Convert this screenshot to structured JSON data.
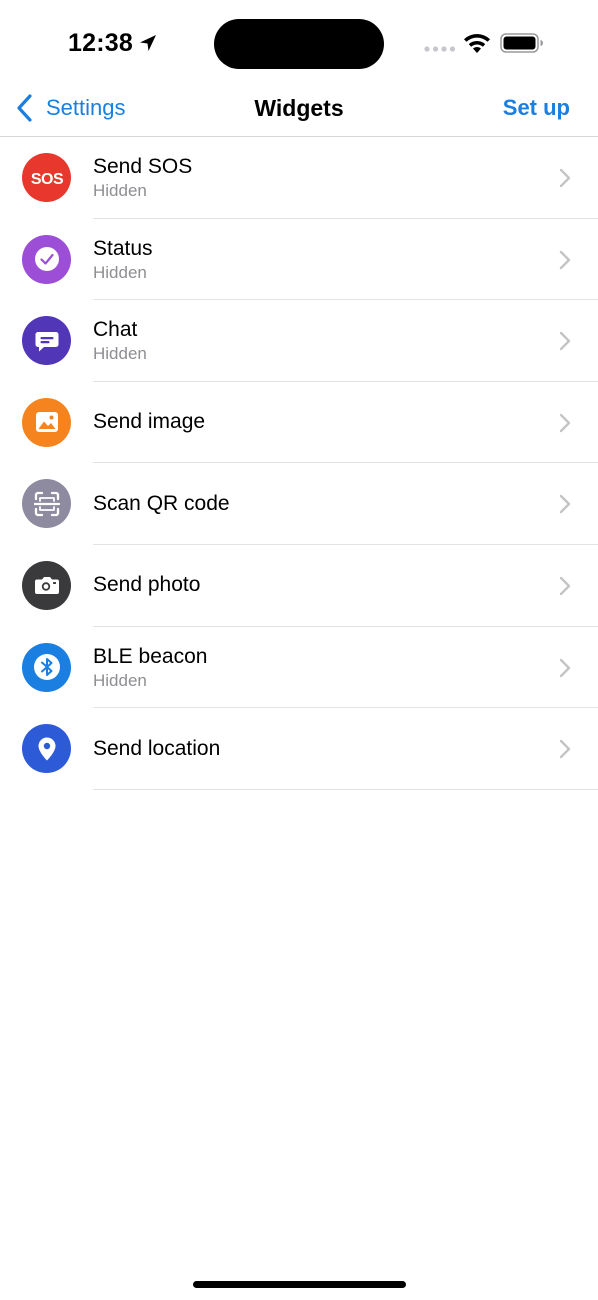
{
  "status_bar": {
    "time": "12:38",
    "icons": [
      "location-arrow-icon",
      "cellular-signal-icon",
      "wifi-icon",
      "battery-icon"
    ]
  },
  "nav": {
    "back_label": "Settings",
    "title": "Widgets",
    "action_label": "Set up"
  },
  "widgets": [
    {
      "title": "Send SOS",
      "subtitle": "Hidden",
      "icon": "sos-icon",
      "color": "#e8382e"
    },
    {
      "title": "Status",
      "subtitle": "Hidden",
      "icon": "checkmark-icon",
      "color": "#9c4fd6"
    },
    {
      "title": "Chat",
      "subtitle": "Hidden",
      "icon": "chat-bubble-icon",
      "color": "#5236b8"
    },
    {
      "title": "Send image",
      "subtitle": "",
      "icon": "image-icon",
      "color": "#f5841f"
    },
    {
      "title": "Scan QR code",
      "subtitle": "",
      "icon": "qr-scan-icon",
      "color": "#8e8aa0"
    },
    {
      "title": "Send photo",
      "subtitle": "",
      "icon": "camera-icon",
      "color": "#3a3a3c"
    },
    {
      "title": "BLE beacon",
      "subtitle": "Hidden",
      "icon": "bluetooth-icon",
      "color": "#1a7fe1"
    },
    {
      "title": "Send location",
      "subtitle": "",
      "icon": "location-pin-icon",
      "color": "#2d5bd8"
    }
  ],
  "colors": {
    "accent": "#1a7fe1",
    "secondary_text": "#8e8e93",
    "separator": "#e2e2e6"
  }
}
